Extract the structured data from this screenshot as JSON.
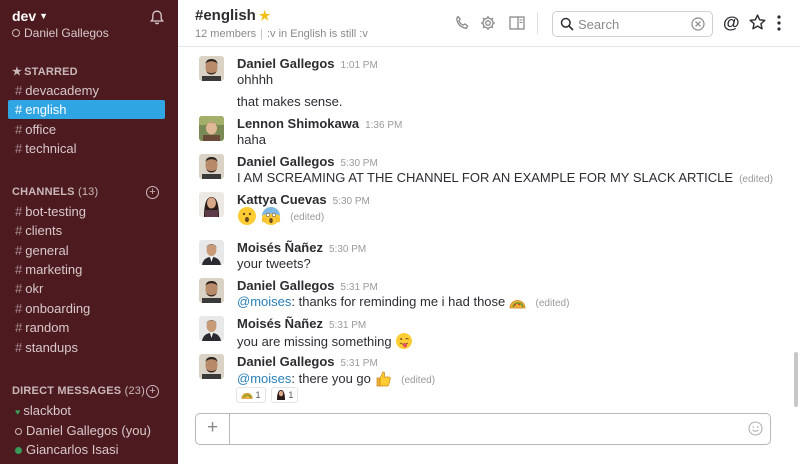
{
  "sidebar": {
    "team_name": "dev",
    "user_name": "Daniel Gallegos",
    "starred": {
      "label": "STARRED",
      "items": [
        {
          "label": "devacademy",
          "active": false
        },
        {
          "label": "english",
          "active": true
        },
        {
          "label": "office",
          "active": false
        },
        {
          "label": "technical",
          "active": false
        }
      ]
    },
    "channels": {
      "label": "CHANNELS",
      "count": "(13)",
      "items": [
        {
          "label": "bot-testing"
        },
        {
          "label": "clients"
        },
        {
          "label": "general"
        },
        {
          "label": "marketing"
        },
        {
          "label": "okr"
        },
        {
          "label": "onboarding"
        },
        {
          "label": "random"
        },
        {
          "label": "standups"
        }
      ]
    },
    "direct_messages": {
      "label": "DIRECT MESSAGES",
      "count": "(23)",
      "items": [
        {
          "label": "slackbot",
          "presence": "bot"
        },
        {
          "label": "Daniel Gallegos (you)",
          "presence": "away"
        },
        {
          "label": "Giancarlos Isasi",
          "presence": "online"
        }
      ]
    }
  },
  "header": {
    "channel_name": "#english",
    "members": "12 members",
    "topic": ":v in English is still :v",
    "search_placeholder": "Search",
    "icons": [
      "phone-icon",
      "gear-icon",
      "sidebar-toggle-icon",
      "search-icon",
      "clear-icon",
      "at-icon",
      "star-icon",
      "more-icon"
    ]
  },
  "messages": {
    "m1": {
      "author": "Daniel Gallegos",
      "time": "1:01 PM",
      "lines": [
        "ohhhh",
        "that makes sense."
      ]
    },
    "m2": {
      "author": "Lennon Shimokawa",
      "time": "1:36 PM",
      "text": "haha"
    },
    "m3": {
      "author": "Daniel Gallegos",
      "time": "5:30 PM",
      "text": "I AM SCREAMING AT THE CHANNEL FOR AN EXAMPLE FOR MY SLACK ARTICLE",
      "edited": "(edited)"
    },
    "m4": {
      "author": "Kattya Cuevas",
      "time": "5:30 PM",
      "edited": "(edited)"
    },
    "m5": {
      "author": "Moisés Ñañez",
      "time": "5:30 PM",
      "text": "your tweets?"
    },
    "m6": {
      "author": "Daniel Gallegos",
      "time": "5:31 PM",
      "mention": "@moises",
      "text": ": thanks for reminding me i had those",
      "edited": "(edited)"
    },
    "m7": {
      "author": "Moisés Ñañez",
      "time": "5:31 PM",
      "text": "you are missing something"
    },
    "m8": {
      "author": "Daniel Gallegos",
      "time": "5:31 PM",
      "mention": "@moises",
      "text": ": there you go",
      "edited": "(edited)"
    },
    "reactions": [
      {
        "emoji": "taco",
        "count": "1"
      },
      {
        "emoji": "person",
        "count": "1"
      }
    ]
  },
  "colors": {
    "sidebar_bg": "#4d1a1f",
    "active_channel": "#2fa6e3",
    "mention": "#2a80b9",
    "presence_online": "#3a9a5a"
  }
}
